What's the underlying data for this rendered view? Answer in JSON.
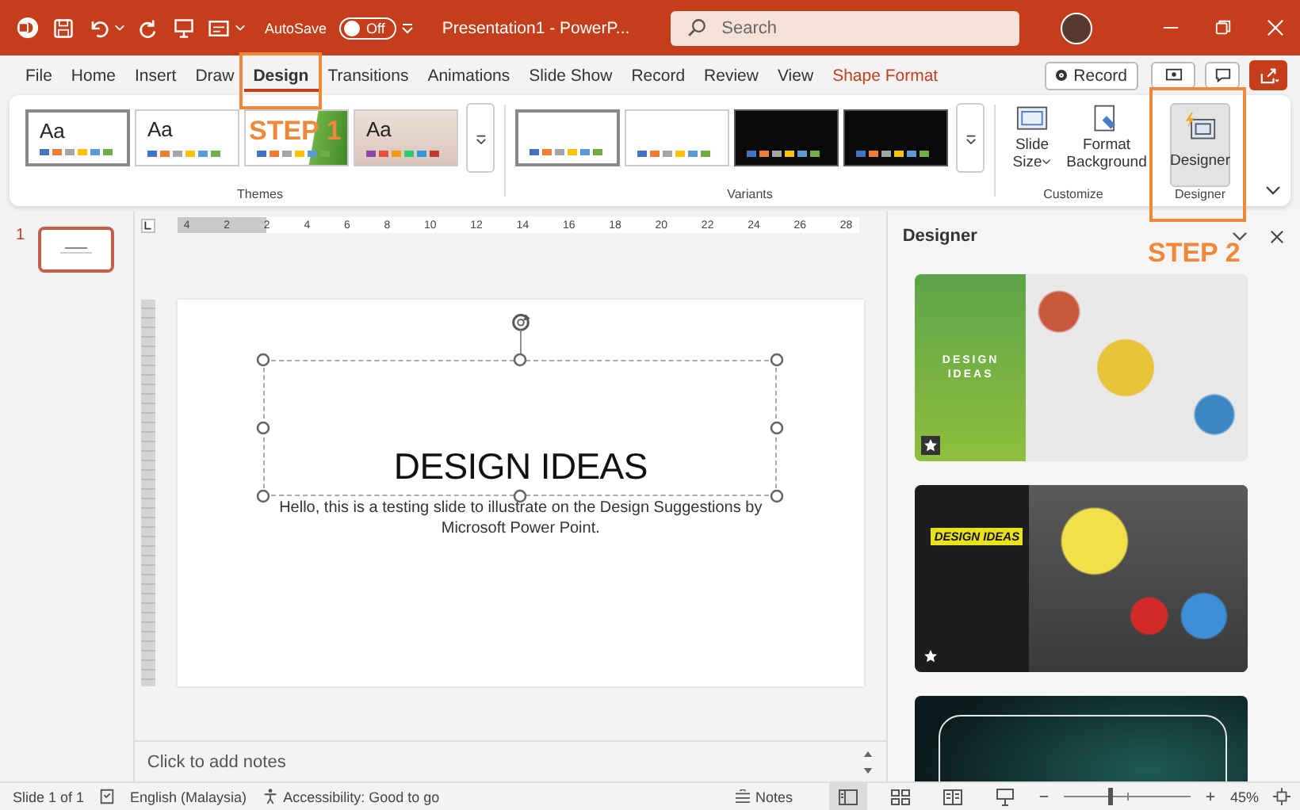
{
  "title_bar": {
    "autosave_label": "AutoSave",
    "autosave_state": "Off",
    "autosave_on": false,
    "document_title": "Presentation1  -  PowerP...",
    "search": {
      "placeholder": "Search"
    }
  },
  "menu_tabs": [
    {
      "label": "File",
      "selected": false,
      "kind": "standard"
    },
    {
      "label": "Home",
      "selected": false,
      "kind": "standard"
    },
    {
      "label": "Insert",
      "selected": false,
      "kind": "standard"
    },
    {
      "label": "Draw",
      "selected": false,
      "kind": "standard"
    },
    {
      "label": "Design",
      "selected": true,
      "kind": "standard"
    },
    {
      "label": "Transitions",
      "selected": false,
      "kind": "standard"
    },
    {
      "label": "Animations",
      "selected": false,
      "kind": "standard"
    },
    {
      "label": "Slide Show",
      "selected": false,
      "kind": "standard"
    },
    {
      "label": "Record",
      "selected": false,
      "kind": "standard"
    },
    {
      "label": "Review",
      "selected": false,
      "kind": "standard"
    },
    {
      "label": "View",
      "selected": false,
      "kind": "standard"
    },
    {
      "label": "Shape Format",
      "selected": false,
      "kind": "contextual"
    }
  ],
  "record_button": "Record",
  "ribbon": {
    "themes": {
      "label": "Themes",
      "items": [
        {
          "preview": "Aa",
          "kind": "white",
          "selected": true
        },
        {
          "preview": "Aa",
          "kind": "white",
          "selected": false
        },
        {
          "kind": "green",
          "selected": false
        },
        {
          "preview": "Aa",
          "kind": "beige",
          "selected": false
        }
      ]
    },
    "variants": {
      "label": "Variants",
      "items": [
        {
          "kind": "light",
          "selected": true
        },
        {
          "kind": "light",
          "selected": false
        },
        {
          "kind": "dark",
          "selected": false
        },
        {
          "kind": "dark",
          "selected": false
        }
      ]
    },
    "customize": {
      "label": "Customize",
      "buttons": [
        {
          "label": "Slide Size",
          "kind": "slide-size",
          "has_menu": true
        },
        {
          "label": "Format Background",
          "kind": "format-background",
          "has_menu": false
        }
      ]
    },
    "designer": {
      "label": "Designer",
      "button": "Designer",
      "pressed": true
    }
  },
  "annotations": [
    {
      "label": "STEP 1",
      "kind": "tab"
    },
    {
      "label": "STEP 2",
      "kind": "designer"
    }
  ],
  "slides_pane": [
    {
      "number": "1",
      "selected": true
    }
  ],
  "ruler_labels": [
    "4",
    "2",
    "2",
    "4",
    "6",
    "8",
    "10",
    "12",
    "14",
    "16",
    "18",
    "20",
    "22",
    "24",
    "26",
    "28"
  ],
  "slide": {
    "title": "DESIGN IDEAS",
    "subtitle": "Hello, this is a testing slide to illustrate on the Design Suggestions by Microsoft Power Point.",
    "title_selected": true
  },
  "notes": {
    "placeholder": "Click to add notes"
  },
  "designer_pane": {
    "title": "Designer",
    "suggestions": [
      {
        "kind": "green-collage",
        "heading": "DESIGN IDEAS"
      },
      {
        "kind": "dark-bulbs",
        "heading": "DESIGN IDEAS"
      },
      {
        "kind": "dark-teal"
      }
    ]
  },
  "status_bar": {
    "slide_info": "Slide 1 of 1",
    "language": "English (Malaysia)",
    "accessibility": "Accessibility: Good to go",
    "notes": "Notes",
    "views": [
      {
        "kind": "normal",
        "selected": true
      },
      {
        "kind": "sorter",
        "selected": false
      },
      {
        "kind": "reading",
        "selected": false
      },
      {
        "kind": "slideshow",
        "selected": false
      }
    ],
    "zoom": {
      "level": 0.35,
      "reading": "45%"
    }
  }
}
